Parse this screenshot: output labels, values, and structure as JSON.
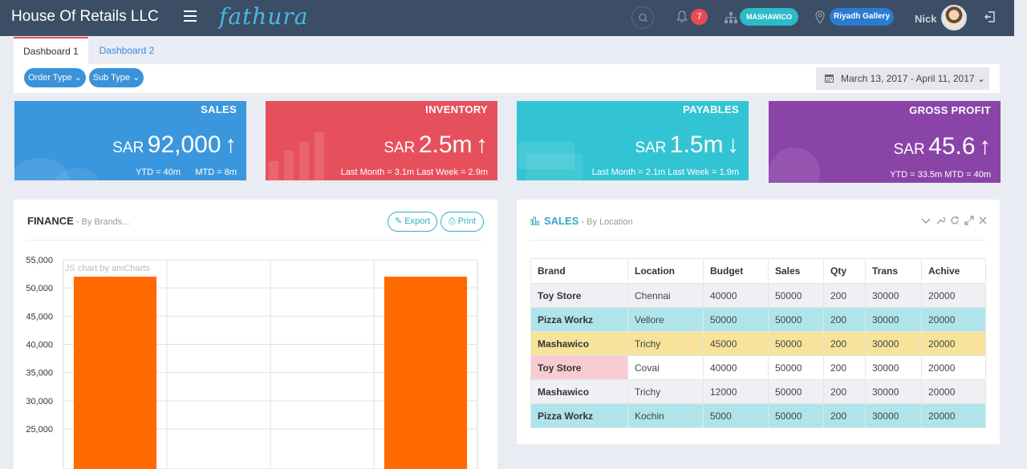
{
  "header": {
    "company": "House Of Retails LLC",
    "logo": "fathura",
    "notifications": "7",
    "company_pill": "MASHAWICO",
    "branch_pill": "Riyadh Gallery",
    "username": "Nick"
  },
  "tabs": [
    "Dashboard 1",
    "Dashboard 2"
  ],
  "filters": {
    "order_type": "Order Type",
    "sub_type": "Sub Type",
    "date_range": "March 13, 2017 - April 11, 2017"
  },
  "kpis": {
    "sales": {
      "title": "SALES",
      "currency": "SAR",
      "value": "92,000",
      "arrow": "↑",
      "sub": "YTD = 40m      MTD = 8m"
    },
    "inventory": {
      "title": "INVENTORY",
      "currency": "SAR",
      "value": "2.5m",
      "arrow": "↑",
      "sub": "Last Month = 3.1m Last Week = 2.9m"
    },
    "payables": {
      "title": "PAYABLES",
      "currency": "SAR",
      "value": "1.5m",
      "arrow": "↓",
      "sub": "Last Month = 2.1m Last Week = 1.9m"
    },
    "gross_profit": {
      "title": "GROSS PROFIT",
      "currency": "SAR",
      "value": "45.6",
      "arrow": "↑",
      "sub": "YTD = 33.5m MTD = 40m"
    }
  },
  "finance": {
    "title": "FINANCE",
    "subtitle": " - By Brands...",
    "export": "Export",
    "print": "Print",
    "watermark": "JS chart by amCharts"
  },
  "chart_data": {
    "type": "bar",
    "title": "FINANCE",
    "subtitle": "By Brands...",
    "categories": [
      "",
      "",
      "",
      ""
    ],
    "values": [
      52000,
      null,
      null,
      52000
    ],
    "ylim": [
      25000,
      55000
    ],
    "yticks": [
      "55,000",
      "50,000",
      "45,000",
      "40,000",
      "35,000",
      "30,000",
      "25,000"
    ],
    "bar_color": "#ff6a00",
    "grid": true
  },
  "sales_panel": {
    "title": "SALES",
    "subtitle": " - By Location",
    "columns": [
      "Brand",
      "Location",
      "Budget",
      "Sales",
      "Qty",
      "Trans",
      "Achive"
    ],
    "rows": [
      {
        "style": "grey",
        "cells": [
          "Toy Store",
          "Chennai",
          "40000",
          "50000",
          "200",
          "30000",
          "20000"
        ]
      },
      {
        "style": "cyan",
        "cells": [
          "Pizza Workz",
          "Vellore",
          "50000",
          "50000",
          "200",
          "30000",
          "20000"
        ]
      },
      {
        "style": "yellow",
        "cells": [
          "Mashawico",
          "Trichy",
          "45000",
          "50000",
          "200",
          "30000",
          "20000"
        ]
      },
      {
        "style": "pink",
        "cells": [
          "Toy Store",
          "Covai",
          "40000",
          "50000",
          "200",
          "30000",
          "20000"
        ]
      },
      {
        "style": "grey",
        "cells": [
          "Mashawico",
          "Trichy",
          "12000",
          "50000",
          "200",
          "30000",
          "20000"
        ]
      },
      {
        "style": "cyan",
        "cells": [
          "Pizza Workz",
          "Kochin",
          "5000",
          "50000",
          "200",
          "30000",
          "20000"
        ]
      }
    ]
  }
}
